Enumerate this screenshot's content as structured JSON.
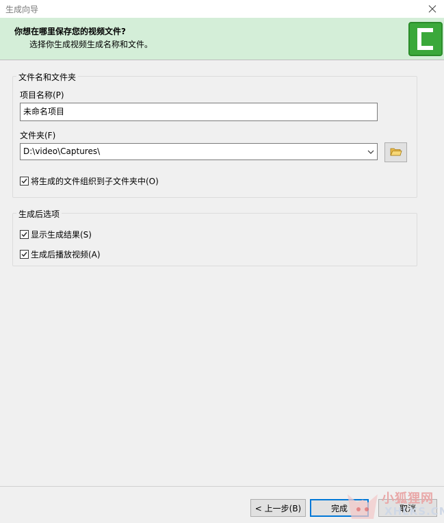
{
  "window": {
    "title": "生成向导"
  },
  "header": {
    "title": "你想在哪里保存您的视频文件?",
    "subtitle": "选择你生成视频生成名称和文件。"
  },
  "file_group": {
    "label": "文件名和文件夹",
    "project_name_label": "项目名称(P)",
    "project_name_value": "未命名项目",
    "folder_label": "文件夹(F)",
    "folder_value": "D:\\video\\Captures\\",
    "organize_checkbox": {
      "label": "将生成的文件组织到子文件夹中(O)",
      "checked": true
    }
  },
  "post_group": {
    "label": "生成后选项",
    "show_results": {
      "label": "显示生成结果(S)",
      "checked": true
    },
    "play_video": {
      "label": "生成后播放视频(A)",
      "checked": true
    }
  },
  "footer": {
    "back_label": "< 上一步(B)",
    "finish_label": "完成",
    "cancel_label": "取消"
  },
  "watermark": {
    "line1": "小狐狸网",
    "line2": "XHLKS.CN"
  },
  "colors": {
    "header_bg": "#d4eed8",
    "logo_green": "#3aa83a",
    "accent": "#0078d7"
  }
}
